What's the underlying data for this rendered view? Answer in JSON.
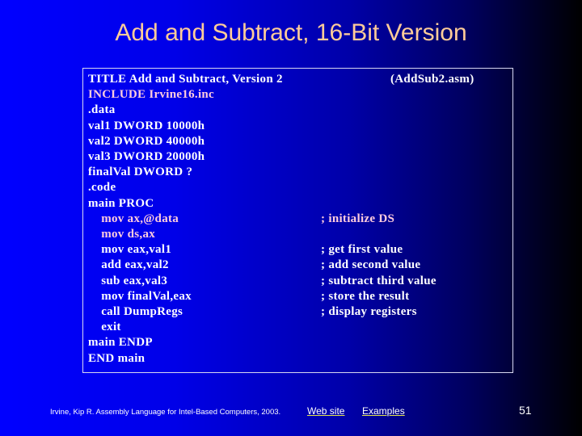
{
  "slide": {
    "title": "Add and Subtract, 16-Bit Version",
    "filename": "(AddSub2.asm)",
    "code_lines": [
      {
        "text": "TITLE Add and Subtract, Version 2",
        "comment": "",
        "highlight": false
      },
      {
        "text": "INCLUDE Irvine16.inc",
        "comment": "",
        "highlight": true
      },
      {
        "text": ".data",
        "comment": "",
        "highlight": false
      },
      {
        "text": "val1 DWORD 10000h",
        "comment": "",
        "highlight": false
      },
      {
        "text": "val2 DWORD 40000h",
        "comment": "",
        "highlight": false
      },
      {
        "text": "val3 DWORD 20000h",
        "comment": "",
        "highlight": false
      },
      {
        "text": "finalVal DWORD ?",
        "comment": "",
        "highlight": false
      },
      {
        "text": ".code",
        "comment": "",
        "highlight": false
      },
      {
        "text": "main PROC",
        "comment": "",
        "highlight": false
      },
      {
        "text": "    mov ax,@data",
        "comment": "; initialize DS",
        "highlight": true
      },
      {
        "text": "    mov ds,ax",
        "comment": "",
        "highlight": true
      },
      {
        "text": "    mov eax,val1",
        "comment": "; get first value",
        "highlight": false
      },
      {
        "text": "    add eax,val2",
        "comment": "; add second value",
        "highlight": false
      },
      {
        "text": "    sub eax,val3",
        "comment": "; subtract third value",
        "highlight": false
      },
      {
        "text": "    mov finalVal,eax",
        "comment": "; store the result",
        "highlight": false
      },
      {
        "text": "    call DumpRegs",
        "comment": "; display registers",
        "highlight": false
      },
      {
        "text": "    exit",
        "comment": "",
        "highlight": false
      },
      {
        "text": "main ENDP",
        "comment": "",
        "highlight": false
      },
      {
        "text": "END main",
        "comment": "",
        "highlight": false
      }
    ]
  },
  "footer": {
    "citation": "Irvine, Kip R. Assembly Language for Intel-Based Computers, 2003.",
    "web_site_link": "Web site",
    "examples_link": "Examples",
    "page_number": "51"
  },
  "colors": {
    "title": "#ffcc99",
    "highlight_text": "#ffccdd",
    "link_underline": "#e6e64c"
  }
}
